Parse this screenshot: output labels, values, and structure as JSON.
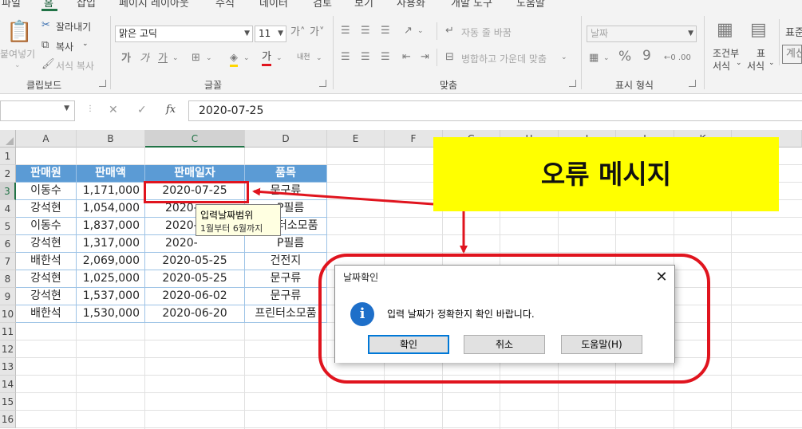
{
  "menu": {
    "tabs": [
      "파일",
      "홈",
      "삽입",
      "페이지 레이아웃",
      "수식",
      "데이터",
      "검토",
      "보기",
      "사용화",
      "개발 도구",
      "도움말"
    ],
    "selected": "홈"
  },
  "ribbon": {
    "clipboard": {
      "paste": "붙여넣기",
      "cut": "잘라내기",
      "copy": "복사",
      "format_painter": "서식 복사",
      "group_label": "클립보드"
    },
    "font": {
      "font_name": "맑은 고딕",
      "font_size": "11",
      "grow_glyph": "가˄",
      "shrink_glyph": "가˅",
      "bold_glyph": "가",
      "italic_glyph": "가",
      "underline_glyph": "가",
      "group_label": "글꼴",
      "color_glyph": "가",
      "phonetic_glyph": "내천"
    },
    "alignment": {
      "wrap_text": "자동 줄 바꿈",
      "merge_center": "병합하고 가운데 맞춤",
      "group_label": "맞춤"
    },
    "number": {
      "format": "날짜",
      "percent": "%",
      "comma": "9",
      "group_label": "표시 형식",
      "decimal_glyph": "←0 .00"
    },
    "styles": {
      "conditional_top": "조건부",
      "conditional_bottom": "서식",
      "table_top": "표",
      "table_bottom": "서식",
      "cell_styles_partial": "표준",
      "cell_calc_partial": "계산"
    }
  },
  "formula_bar": {
    "name_box": "",
    "fx_glyph": "fx",
    "cancel_glyph": "✕",
    "enter_glyph": "✓",
    "value": "2020-07-25"
  },
  "grid": {
    "columns": [
      "A",
      "B",
      "C",
      "D",
      "E",
      "F",
      "G",
      "H",
      "I",
      "J",
      "K"
    ],
    "active_column": "C",
    "rows": [
      "1",
      "2",
      "3",
      "4",
      "5",
      "6",
      "7",
      "8",
      "9",
      "10",
      "11",
      "12",
      "13",
      "14",
      "15",
      "16"
    ],
    "active_row": "3",
    "table_headers": [
      "판매원",
      "판매액",
      "판매일자",
      "품목"
    ],
    "table_rows": [
      [
        "이동수",
        "1,171,000",
        "2020-07-25",
        "문구류"
      ],
      [
        "강석현",
        "1,054,000",
        "2020-",
        "P필름"
      ],
      [
        "이동수",
        "1,837,000",
        "2020-",
        "터소모품"
      ],
      [
        "강석현",
        "1,317,000",
        "2020-",
        "P필름"
      ],
      [
        "배한석",
        "2,069,000",
        "2020-05-25",
        "건전지"
      ],
      [
        "강석현",
        "1,025,000",
        "2020-05-25",
        "문구류"
      ],
      [
        "강석현",
        "1,537,000",
        "2020-06-02",
        "문구류"
      ],
      [
        "배한석",
        "1,530,000",
        "2020-06-20",
        "프린터소모품"
      ]
    ]
  },
  "input_tooltip": {
    "title": "입력날짜범위",
    "message": "1월부터 6월까지"
  },
  "annotation": {
    "label": "오류 메시지",
    "highlight_color": "#ffff00",
    "marker_color": "#e0141e"
  },
  "dialog": {
    "title": "날짜확인",
    "close_glyph": "✕",
    "icon": "info-icon",
    "icon_glyph": "i",
    "message": "입력 날짜가 정확한지 확인 바랍니다.",
    "buttons": {
      "ok": "확인",
      "cancel": "취소",
      "help": "도움말(H)"
    }
  },
  "colors": {
    "accent": "#217346",
    "table_header": "#5b9bd5"
  }
}
